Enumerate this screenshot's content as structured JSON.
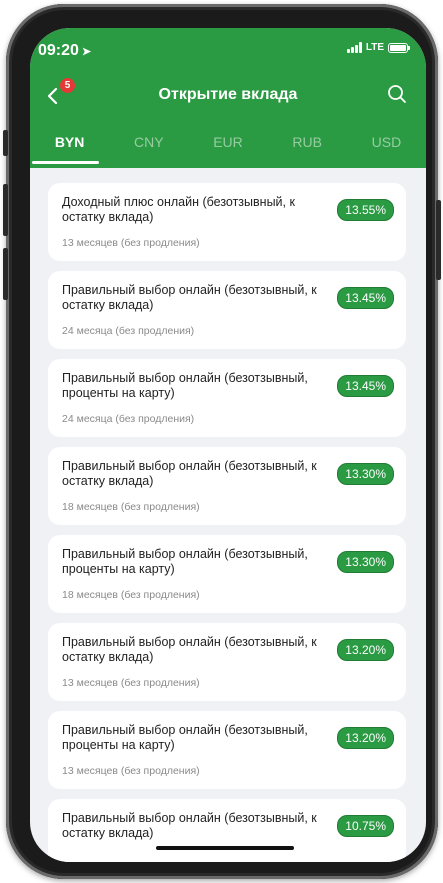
{
  "status": {
    "time": "09:20",
    "network": "LTE"
  },
  "header": {
    "back_badge": "5",
    "title": "Открытие вклада"
  },
  "tabs": [
    {
      "label": "BYN",
      "active": true
    },
    {
      "label": "CNY",
      "active": false
    },
    {
      "label": "EUR",
      "active": false
    },
    {
      "label": "RUB",
      "active": false
    },
    {
      "label": "USD",
      "active": false
    }
  ],
  "deposits": [
    {
      "title": "Доходный плюс онлайн (безотзывный, к остатку вклада)",
      "term": "13 месяцев (без продления)",
      "rate": "13.55%"
    },
    {
      "title": "Правильный выбор онлайн (безотзывный, к остатку вклада)",
      "term": "24 месяца (без продления)",
      "rate": "13.45%"
    },
    {
      "title": "Правильный выбор онлайн (безотзывный, проценты на карту)",
      "term": "24 месяца (без продления)",
      "rate": "13.45%"
    },
    {
      "title": "Правильный выбор онлайн (безотзывный, к остатку вклада)",
      "term": "18 месяцев (без продления)",
      "rate": "13.30%"
    },
    {
      "title": "Правильный выбор онлайн (безотзывный, проценты на карту)",
      "term": "18 месяцев (без продления)",
      "rate": "13.30%"
    },
    {
      "title": "Правильный выбор онлайн (безотзывный, к остатку вклада)",
      "term": "13 месяцев (без продления)",
      "rate": "13.20%"
    },
    {
      "title": "Правильный выбор онлайн (безотзывный, проценты на карту)",
      "term": "13 месяцев (без продления)",
      "rate": "13.20%"
    },
    {
      "title": "Правильный выбор онлайн (безотзывный, к остатку вклада)",
      "term": "",
      "rate": "10.75%"
    }
  ],
  "colors": {
    "brand_green": "#2a9a43",
    "badge_red": "#e53935",
    "background": "#f0f1f4"
  },
  "icons": {
    "back": "chevron-left-icon",
    "search": "search-icon",
    "location": "location-arrow-icon"
  }
}
